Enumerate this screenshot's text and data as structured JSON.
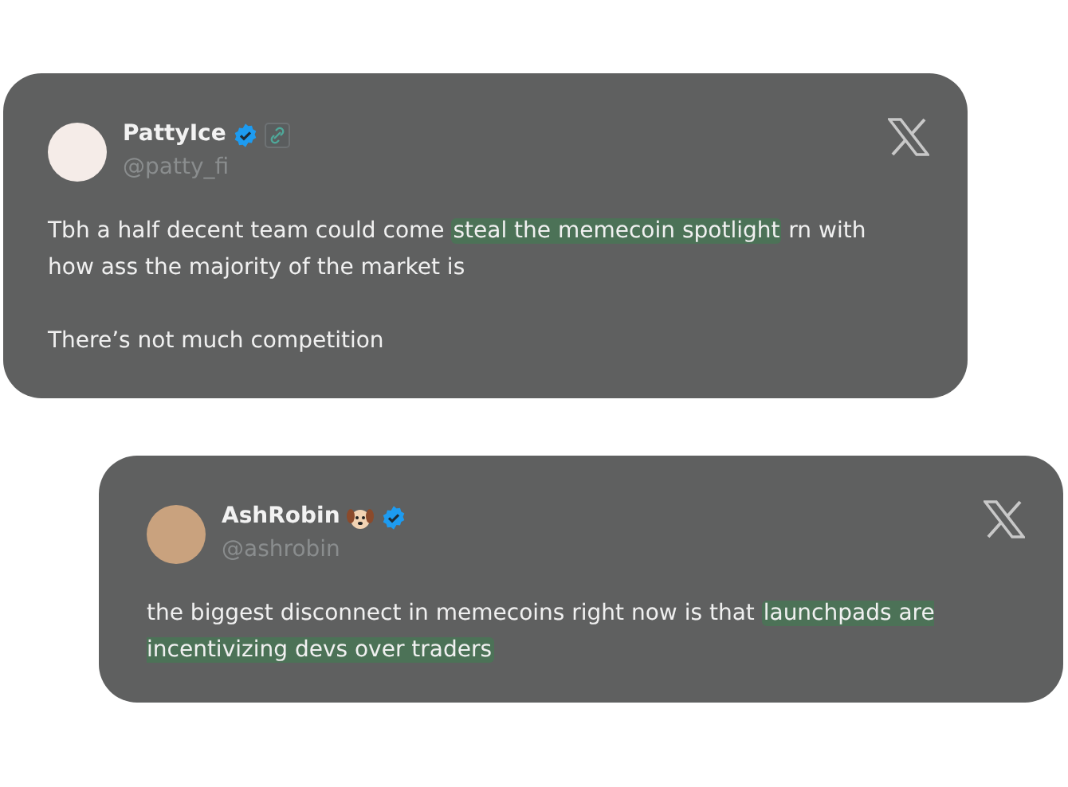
{
  "tweets": [
    {
      "name": "PattyIce",
      "handle": "@patty_fi",
      "verified": true,
      "kind": "link",
      "paragraphs": [
        [
          {
            "text": "Tbh a half decent team could come ",
            "highlight": false
          },
          {
            "text": "steal the memecoin spotlight",
            "highlight": true
          },
          {
            "text": " rn with how ass the majority of the market is",
            "highlight": false
          }
        ],
        [
          {
            "text": "There’s not much competition",
            "highlight": false
          }
        ]
      ]
    },
    {
      "name": "AshRobin",
      "handle": "@ashrobin",
      "verified": true,
      "kind": "dog",
      "paragraphs": [
        [
          {
            "text": "the biggest disconnect in memecoins right now is that ",
            "highlight": false
          },
          {
            "text": "launchpads are incentivizing devs over traders",
            "highlight": true
          }
        ]
      ]
    }
  ]
}
